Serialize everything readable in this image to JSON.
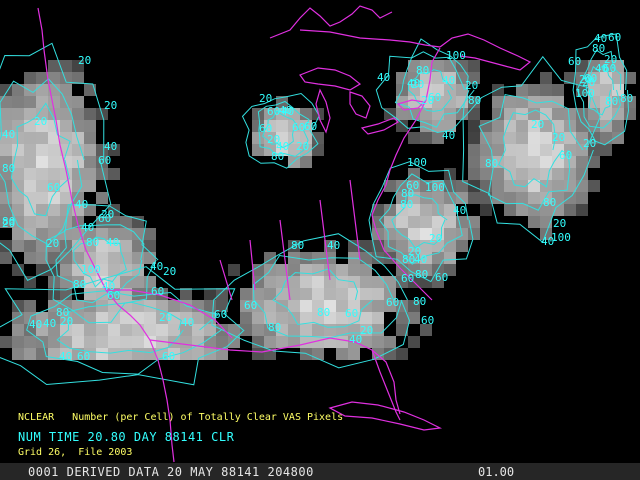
{
  "captions": {
    "field_line": "NCLEAR   Number (per Cell) of Totally Clear VAS Pixels",
    "time_line": "NUM TIME 20.80 DAY 88141 CLR",
    "grid_line": "Grid 26,  File 2003"
  },
  "status_bar": {
    "left_text": "0001 DERIVED DATA 20 MAY 88141 204800",
    "right_text": "01.00"
  },
  "colors": {
    "background": "#000000",
    "contour": "#33e0e0",
    "contour_label": "#33ffff",
    "boundaries": "#e030e0",
    "caption_yellow": "#ffff66",
    "caption_cyan": "#33ffff"
  },
  "contour_labels": [
    "20",
    "40",
    "60",
    "80",
    "100",
    "20",
    "40",
    "60",
    "80",
    "20",
    "40",
    "60",
    "80",
    "100",
    "20",
    "40",
    "60",
    "80",
    "20",
    "40",
    "60",
    "80",
    "20",
    "40",
    "60",
    "80",
    "20",
    "40",
    "60",
    "80",
    "100",
    "20",
    "40",
    "60",
    "20",
    "40",
    "60",
    "80",
    "20",
    "40",
    "60",
    "80",
    "20",
    "40",
    "60",
    "20",
    "40",
    "60",
    "80",
    "20",
    "40",
    "60",
    "80",
    "20",
    "40",
    "60",
    "80",
    "100",
    "20",
    "40",
    "60",
    "20",
    "40",
    "60",
    "80",
    "20",
    "40",
    "60",
    "80",
    "20",
    "40",
    "60",
    "80",
    "20",
    "40",
    "60",
    "80",
    "100",
    "20",
    "40",
    "60",
    "80",
    "20",
    "40",
    "60",
    "80",
    "20",
    "40",
    "60",
    "80",
    "20",
    "40",
    "60",
    "20",
    "40",
    "60",
    "80",
    "100",
    "20",
    "40",
    "60",
    "80"
  ]
}
